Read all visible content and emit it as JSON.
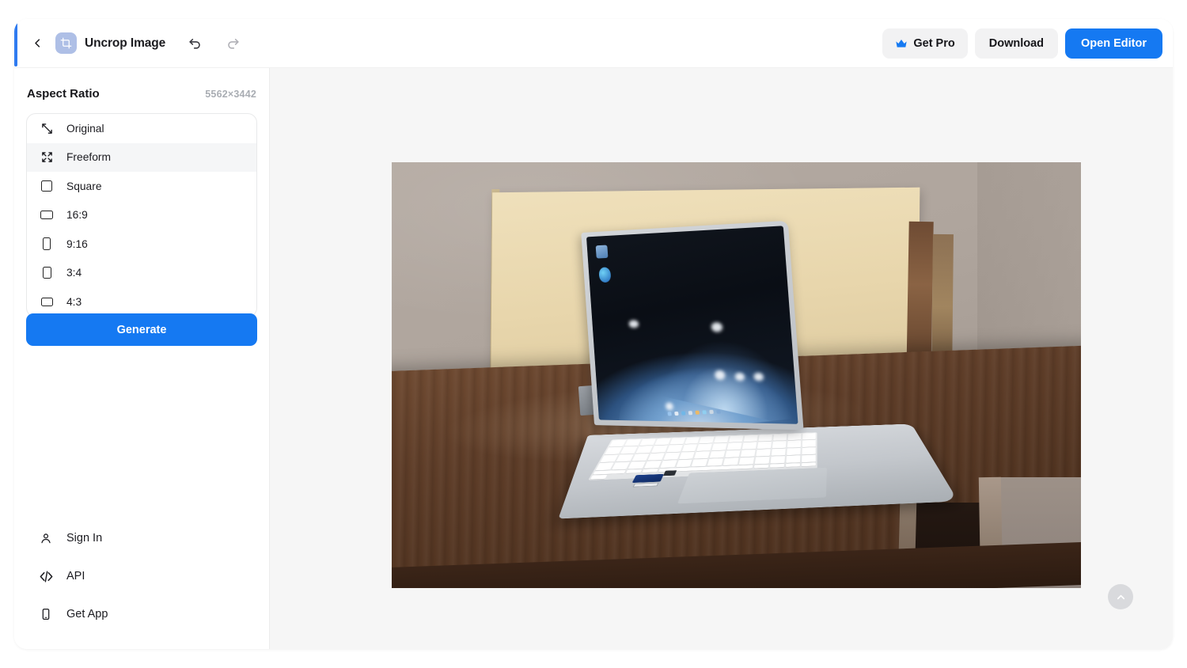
{
  "window": {
    "accent_color": "#2f7bf0"
  },
  "header": {
    "back_label": "Back",
    "app_icon": "crop-icon",
    "title": "Uncrop Image",
    "undo_label": "Undo",
    "redo_label": "Redo",
    "buttons": {
      "get_pro": "Get Pro",
      "get_pro_icon": "crown-icon",
      "download": "Download",
      "open_editor": "Open Editor",
      "primary_color": "#1579f2"
    }
  },
  "sidebar": {
    "section_title": "Aspect Ratio",
    "dimensions": "5562×3442",
    "ratios": [
      {
        "label": "Original",
        "icon": "diagonal-resize-icon",
        "active": false
      },
      {
        "label": "Freeform",
        "icon": "expand-arrows-icon",
        "active": true
      },
      {
        "label": "Square",
        "icon": "square-icon",
        "active": false
      },
      {
        "label": "16:9",
        "icon": "landscape-rect-icon",
        "active": false
      },
      {
        "label": "9:16",
        "icon": "portrait-rect-icon",
        "active": false
      },
      {
        "label": "3:4",
        "icon": "portrait-rect-icon",
        "active": false
      },
      {
        "label": "4:3",
        "icon": "landscape-rect-icon",
        "active": false
      }
    ],
    "generate_label": "Generate",
    "links": [
      {
        "label": "Sign In",
        "icon": "user-icon"
      },
      {
        "label": "API",
        "icon": "code-icon"
      },
      {
        "label": "Get App",
        "icon": "mobile-phone-icon"
      }
    ]
  },
  "canvas": {
    "image_alt": "Silver laptop with Windows desktop open on a dark wooden table",
    "background_color": "#f6f6f6",
    "handles": [
      "top",
      "bottom",
      "left",
      "right"
    ],
    "scroll_top_icon": "chevron-up-icon"
  }
}
